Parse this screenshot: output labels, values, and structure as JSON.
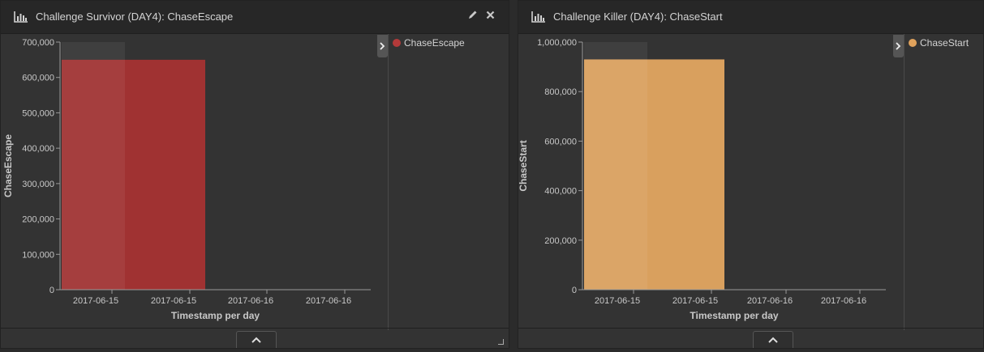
{
  "panels": [
    {
      "title": "Challenge Survivor (DAY4): ChaseEscape",
      "icons": [
        "bar-chart-icon",
        "pencil-icon",
        "close-icon"
      ],
      "legend": [
        {
          "label": "ChaseEscape",
          "color": "#b33a3a"
        }
      ],
      "chart_data": {
        "type": "bar",
        "x_tick_labels": [
          "2017-06-15",
          "2017-06-15",
          "2017-06-16",
          "2017-06-16"
        ],
        "categories": [
          "2017-06-15"
        ],
        "values": [
          650000
        ],
        "xlabel": "Timestamp per day",
        "ylabel": "ChaseEscape",
        "ylim": [
          0,
          700000
        ],
        "yticks": [
          "0",
          "100,000",
          "200,000",
          "300,000",
          "400,000",
          "500,000",
          "600,000",
          "700,000"
        ],
        "color": "#a03232",
        "grid": false,
        "legend_position": "right"
      }
    },
    {
      "title": "Challenge Killer (DAY4): ChaseStart",
      "icons": [
        "bar-chart-icon"
      ],
      "legend": [
        {
          "label": "ChaseStart",
          "color": "#e0a25c"
        }
      ],
      "chart_data": {
        "type": "bar",
        "x_tick_labels": [
          "2017-06-15",
          "2017-06-15",
          "2017-06-16",
          "2017-06-16"
        ],
        "categories": [
          "2017-06-15"
        ],
        "values": [
          930000
        ],
        "xlabel": "Timestamp per day",
        "ylabel": "ChaseStart",
        "ylim": [
          0,
          1000000
        ],
        "yticks": [
          "0",
          "200,000",
          "400,000",
          "600,000",
          "800,000",
          "1,000,000"
        ],
        "color": "#d9a05e",
        "grid": false,
        "legend_position": "right"
      }
    }
  ]
}
